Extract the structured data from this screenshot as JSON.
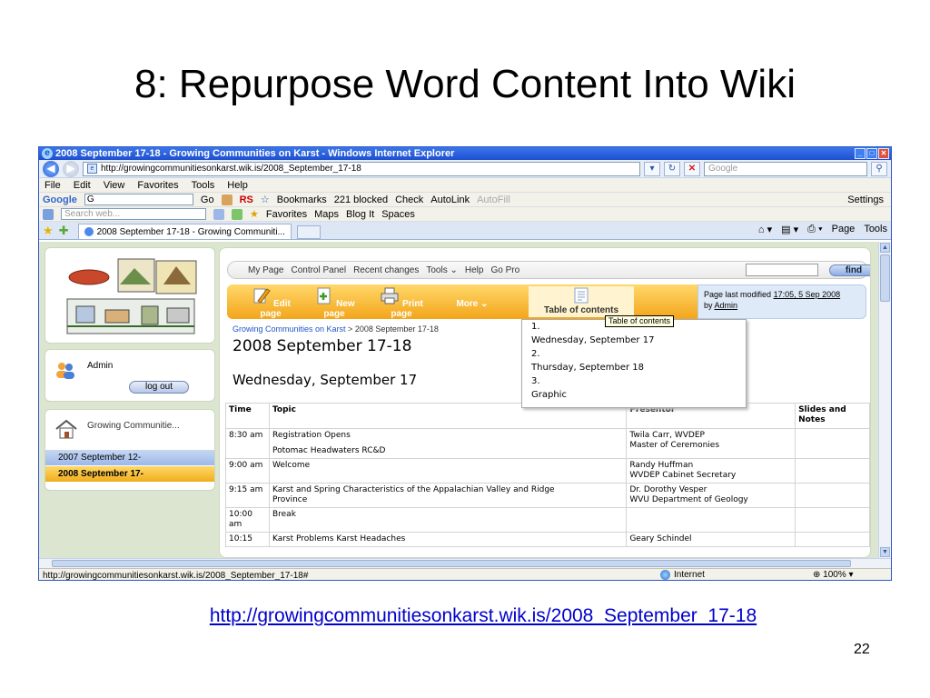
{
  "slide": {
    "title": "8: Repurpose Word Content Into Wiki",
    "link": "http://growingcommunitiesonkarst.wik.is/2008_September_17-18",
    "page_number": "22"
  },
  "browser": {
    "window_title": "2008 September 17-18 - Growing Communities on Karst - Windows Internet Explorer",
    "address": "http://growingcommunitiesonkarst.wik.is/2008_September_17-18",
    "search_placeholder": "Google",
    "menu": [
      "File",
      "Edit",
      "View",
      "Favorites",
      "Tools",
      "Help"
    ],
    "google_toolbar": {
      "logo": "Google",
      "box": "G",
      "go": "Go",
      "rs": "RS",
      "bookmarks": "Bookmarks",
      "blocked": "221 blocked",
      "check": "Check",
      "autolink": "AutoLink",
      "autofill": "AutoFill",
      "settings": "Settings"
    },
    "search_toolbar": {
      "placeholder": "Search web...",
      "favorites": "Favorites",
      "maps": "Maps",
      "blog_it": "Blog It",
      "spaces": "Spaces"
    },
    "tab_title": "2008 September 17-18 - Growing Communiti...",
    "page_menu": "Page",
    "tools_menu": "Tools",
    "status_url": "http://growingcommunitiesonkarst.wik.is/2008_September_17-18#",
    "zone": "Internet",
    "zoom": "100%"
  },
  "wiki": {
    "user": "Admin",
    "logout": "log out",
    "nav_title": "Growing Communitie...",
    "nav_items": [
      "2007 September 12-",
      "2008 September 17-"
    ],
    "top_nav": [
      "My Page",
      "Control Panel",
      "Recent changes",
      "Tools",
      "Help",
      "Go Pro"
    ],
    "find_label": "find",
    "actions": {
      "edit": "Edit page",
      "new": "New page",
      "print": "Print page",
      "more": "More",
      "toc": "Table of contents"
    },
    "modified": {
      "prefix": "Page last modified",
      "time": "17:05, 5 Sep 2008",
      "by": "by",
      "author": "Admin"
    },
    "breadcrumb": {
      "parent": "Growing Communities on Karst",
      "sep": " > ",
      "current": "2008 September 17-18"
    },
    "page_title": "2008 September 17-18",
    "section_title": "Wednesday, September 17",
    "tooltip": "Table of contents",
    "toc_items": [
      "1.",
      "Wednesday, September 17",
      "2.",
      "Thursday, September 18",
      "3.",
      "Graphic"
    ],
    "table": {
      "headers": [
        "Time",
        "Topic",
        "Presentor",
        "Slides and Notes"
      ],
      "rows": [
        {
          "time": "8:30 am",
          "topic1": "Registration Opens",
          "topic2": "Potomac Headwaters RC&D",
          "pres1": "Twila Carr, WVDEP",
          "pres2": "Master of Ceremonies"
        },
        {
          "time": "9:00 am",
          "topic1": "Welcome",
          "topic2": "",
          "pres1": "Randy Huffman",
          "pres2": "WVDEP Cabinet Secretary"
        },
        {
          "time": "9:15 am",
          "topic1": "Karst and Spring Characteristics of the Appalachian Valley and Ridge",
          "topic2": "Province",
          "pres1": "Dr. Dorothy Vesper",
          "pres2": "WVU Department of Geology"
        },
        {
          "time": "10:00 am",
          "topic1": "Break",
          "topic2": "",
          "pres1": "",
          "pres2": ""
        },
        {
          "time": "10:15",
          "topic1": "Karst Problems Karst Headaches",
          "topic2": "",
          "pres1": "Geary Schindel",
          "pres2": ""
        }
      ]
    }
  },
  "colors": {
    "titlebar": "#2a5fd6",
    "orange_bar": "#f3a51a",
    "link": "#0000cc"
  }
}
